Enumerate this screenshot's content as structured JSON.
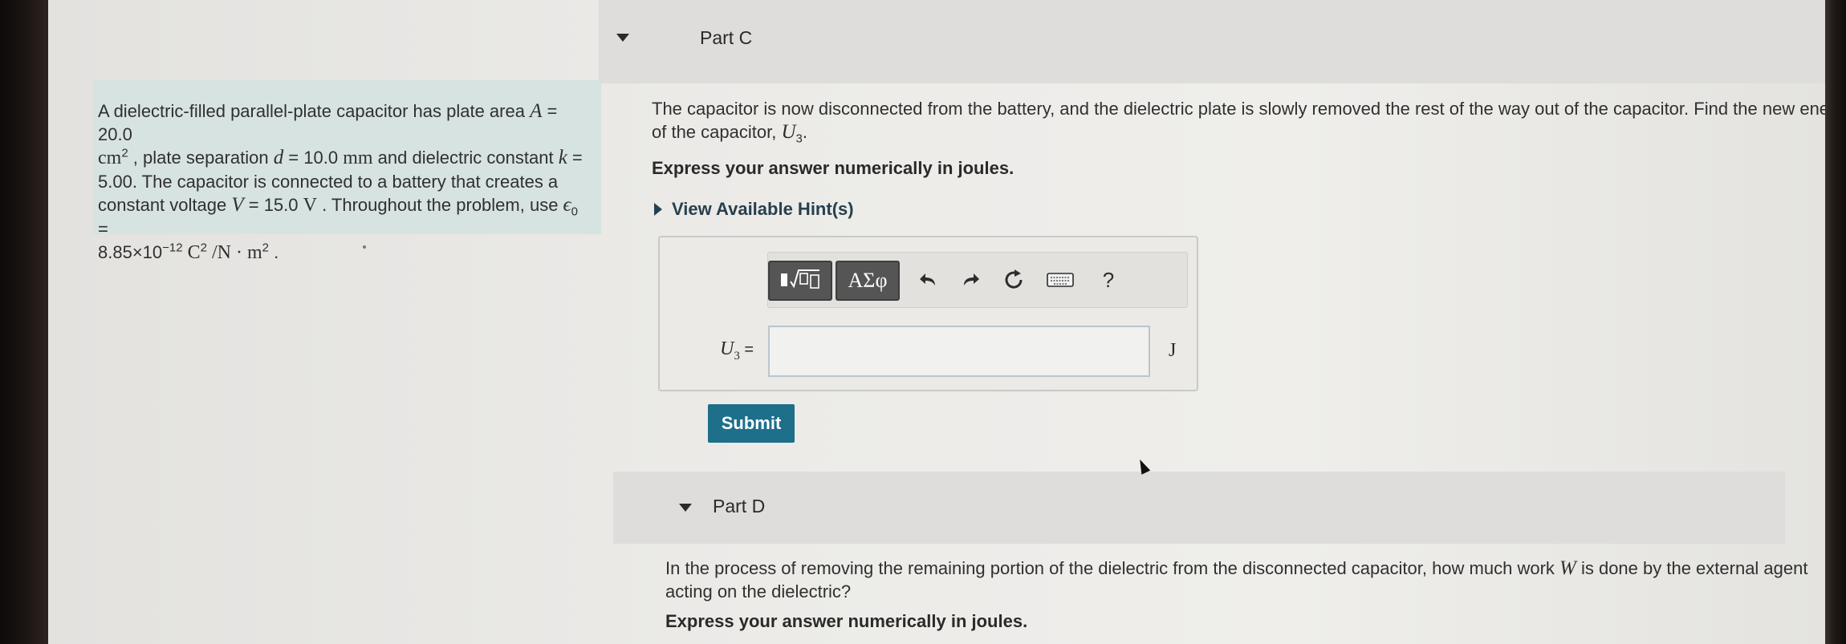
{
  "problem": {
    "text_1": "A dielectric-filled parallel-plate capacitor has plate area ",
    "A_var": "A",
    "A_value": " = 20.0",
    "A_unit": "cm",
    "A_unit_exp": "2",
    "text_2": " , plate separation ",
    "d_var": "d",
    "d_value": " = 10.0 ",
    "d_unit": "mm",
    "text_3": " and dielectric constant ",
    "k_var": "k",
    "k_value": " =",
    "text_4": "5.00. The capacitor is connected to a battery that creates a constant voltage ",
    "V_var": "V",
    "V_value": " = 15.0 ",
    "V_unit": "V",
    "text_5": " . Throughout the problem, use ",
    "eps_var": "ϵ",
    "eps_sub": "0",
    "eps_eq": " =",
    "eps_mantissa": "8.85×10",
    "eps_exp": "−12",
    "eps_unit_C": " C",
    "eps_unit_C_exp": "2",
    "eps_unit_rest": " /N · m",
    "eps_unit_m_exp": "2",
    "end": " ."
  },
  "part_c": {
    "label": "Part C",
    "question": "The capacitor is now disconnected from the battery, and the dielectric plate is slowly removed the rest of the way out of the capacitor. Find the new energy of the capacitor, ",
    "q_var": "U",
    "q_sub": "3",
    "q_end": ".",
    "instruction": "Express your answer numerically in joules.",
    "hint_label": "View Available Hint(s)",
    "toolbar": {
      "templates_icon": "templates-icon",
      "symbols_label": "ΑΣφ",
      "undo_icon": "undo-icon",
      "redo_icon": "redo-icon",
      "reset_icon": "reset-icon",
      "keyboard_icon": "keyboard-icon",
      "help_label": "?"
    },
    "answer_var": "U",
    "answer_sub": "3",
    "answer_eq": " =",
    "answer_value": "",
    "answer_unit": "J",
    "submit_label": "Submit"
  },
  "part_d": {
    "label": "Part D",
    "question_1": "In the process of removing the remaining portion of the dielectric from the disconnected capacitor, how much work ",
    "q_var": "W",
    "question_2": " is done by the external agent acting on the dielectric?",
    "instruction": "Express your answer numerically in joules."
  },
  "colors": {
    "problem_bg": "#d7e3e1",
    "submit_bg": "#1d6f8a",
    "hint_color": "#27404e"
  }
}
